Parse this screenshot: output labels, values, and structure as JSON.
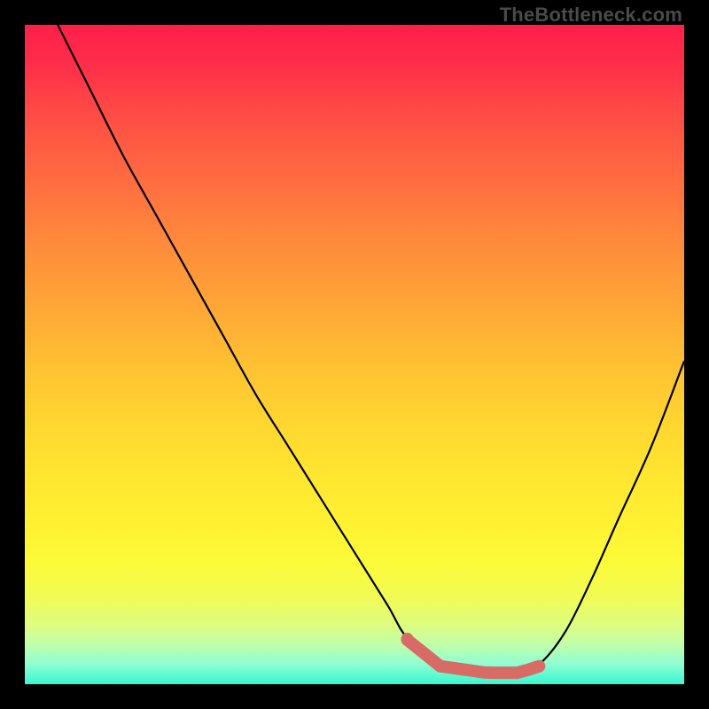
{
  "attribution": "TheBottleneck.com",
  "colors": {
    "frame": "#000000",
    "curve": "#000000",
    "highlight": "#d96b66",
    "gradient_top": "#ff1f4a",
    "gradient_bottom": "#36f7cf"
  },
  "chart_data": {
    "type": "line",
    "title": "",
    "xlabel": "",
    "ylabel": "",
    "xlim": [
      0,
      100
    ],
    "ylim": [
      0,
      100
    ],
    "series": [
      {
        "name": "bottleneck-curve",
        "x": [
          5,
          10,
          15,
          20,
          25,
          30,
          35,
          40,
          45,
          50,
          55,
          58,
          63,
          70,
          75,
          78,
          82,
          86,
          90,
          95,
          100
        ],
        "y": [
          100,
          90,
          80,
          71,
          62,
          53,
          44,
          36,
          28,
          20,
          12,
          7,
          3,
          2,
          2,
          3,
          8,
          16,
          25,
          36,
          49
        ]
      }
    ],
    "annotations": [
      {
        "name": "optimal-range-highlight",
        "x_start": 58,
        "x_end": 78,
        "y_approx": 3
      }
    ]
  }
}
